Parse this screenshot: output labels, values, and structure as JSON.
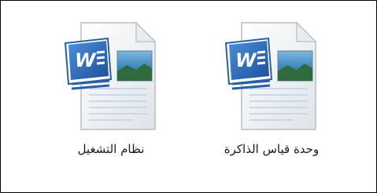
{
  "files": [
    {
      "name": "وحدة قياس الذاكرة",
      "icon": "word-document-icon"
    },
    {
      "name": "نظام التشغيل",
      "icon": "word-document-icon"
    }
  ]
}
